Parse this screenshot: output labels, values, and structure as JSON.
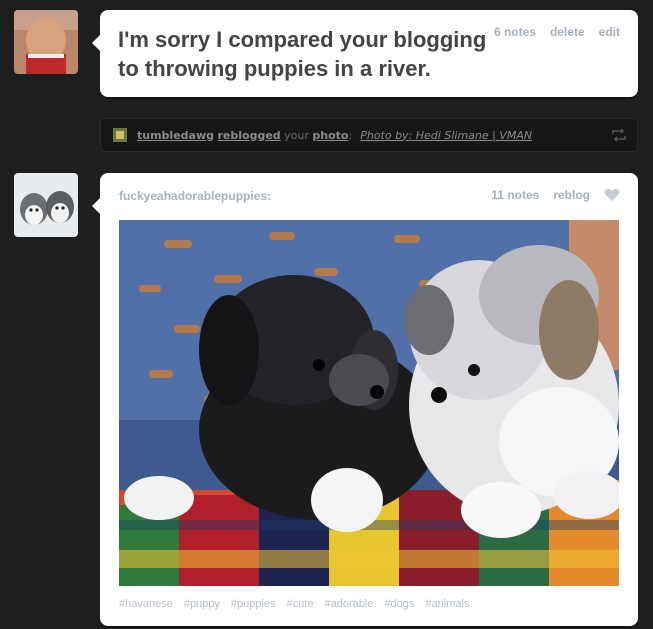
{
  "posts": {
    "quote": {
      "text": "I'm sorry I compared your blogging to throwing puppies in a river.",
      "notes": "6 notes",
      "delete_label": "delete",
      "edit_label": "edit"
    },
    "reblog_notice": {
      "user": "tumbledawg",
      "action": "reblogged",
      "your": "your",
      "photo_word": "photo",
      "colon": ":",
      "caption": "Photo by: Hedi Slimane | VMAN"
    },
    "photo": {
      "source": "fuckyeahadorablepuppies:",
      "notes": "11 notes",
      "reblog_label": "reblog",
      "tags": [
        "#havanese",
        "#puppy",
        "#puppies",
        "#cute",
        "#adorable",
        "#dogs",
        "#animals"
      ]
    }
  },
  "colors": {
    "background": "#1e1e1e",
    "card": "#ffffff",
    "meta_text": "#a8b1ba",
    "quote_text": "#444444"
  },
  "icons": [
    "heart-icon",
    "reblog-icon"
  ]
}
